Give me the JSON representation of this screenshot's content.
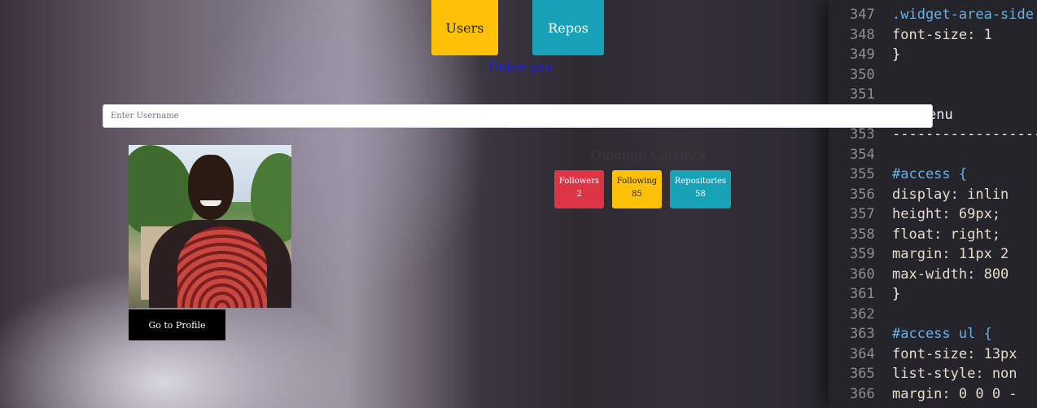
{
  "nav": {
    "users_label": "Users",
    "repos_label": "Repos"
  },
  "search": {
    "label": "Enter you",
    "placeholder": "Enter Username",
    "value": ""
  },
  "profile": {
    "name": "Omonge Calvince",
    "go_to_profile_label": "Go to Profile",
    "stats": {
      "followers_label": "Followers",
      "followers_value": "2",
      "following_label": "Following",
      "following_value": "85",
      "repositories_label": "Repositories",
      "repositories_value": "58"
    }
  },
  "background_code": [
    {
      "ln": "347",
      "text": ".widget-area-side"
    },
    {
      "ln": "348",
      "text": "    font-size: 1"
    },
    {
      "ln": "349",
      "text": "}"
    },
    {
      "ln": "350",
      "text": ""
    },
    {
      "ln": "351",
      "text": ""
    },
    {
      "ln": "",
      "text": "enu"
    },
    {
      "ln": "353",
      "text": "------------------"
    },
    {
      "ln": "354",
      "text": ""
    },
    {
      "ln": "355",
      "text": "#access {"
    },
    {
      "ln": "356",
      "text": "    display: inlin"
    },
    {
      "ln": "357",
      "text": "    height: 69px;"
    },
    {
      "ln": "358",
      "text": "    float: right;"
    },
    {
      "ln": "359",
      "text": "    margin: 11px 2"
    },
    {
      "ln": "360",
      "text": "    max-width: 800"
    },
    {
      "ln": "361",
      "text": "}"
    },
    {
      "ln": "362",
      "text": ""
    },
    {
      "ln": "363",
      "text": "#access ul {"
    },
    {
      "ln": "364",
      "text": "    font-size: 13px"
    },
    {
      "ln": "365",
      "text": "    list-style: non"
    },
    {
      "ln": "366",
      "text": "    margin: 0 0 0 -"
    }
  ],
  "colors": {
    "yellow": "#ffc107",
    "teal": "#17a2b8",
    "red": "#dc3545",
    "label_blue": "#1a1aff"
  }
}
